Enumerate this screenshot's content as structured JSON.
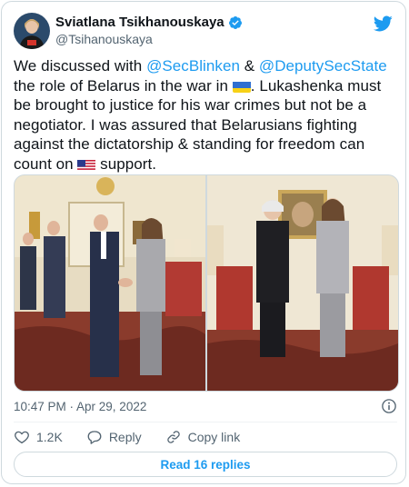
{
  "author": {
    "display_name": "Sviatlana Tsikhanouskaya",
    "handle": "@Tsihanouskaya",
    "verified_icon": "verified-badge-icon",
    "avatar_icon": "profile-photo"
  },
  "tweet": {
    "text_1": "We discussed with ",
    "mention_1": "@SecBlinken",
    "text_2": " & ",
    "mention_2": "@DeputySecState",
    "text_3": " the role of Belarus in the war in ",
    "flag_1": "ukraine-flag-icon",
    "text_4": ". Lukashenka must be brought to justice for his war crimes but not be a negotiator. I was assured that Belarusians fighting against the dictatorship & standing for freedom can count on ",
    "flag_2": "us-flag-icon",
    "text_5": " support."
  },
  "media": {
    "photo_1": "photo-handshake",
    "photo_2": "photo-two-women-standing"
  },
  "meta": {
    "timestamp": "10:47 PM · Apr 29, 2022"
  },
  "actions": {
    "like_count": "1.2K",
    "reply_label": "Reply",
    "copy_link_label": "Copy link"
  },
  "read_replies_label": "Read 16 replies",
  "colors": {
    "accent": "#1d9bf0",
    "text": "#0f1419",
    "secondary": "#536471",
    "border": "#cfd9de"
  }
}
